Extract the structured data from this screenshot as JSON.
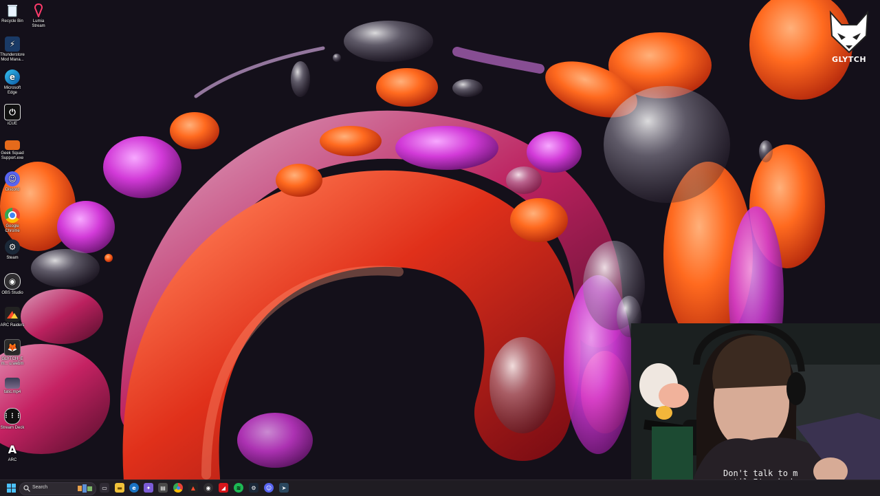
{
  "desktop": {
    "icons": [
      {
        "label": "Recycle Bin",
        "icon": "recycle-bin-icon"
      },
      {
        "label": "Lumia Stream",
        "icon": "lumia-stream-icon"
      },
      {
        "label": "Thunderstore Mod Mana...",
        "icon": "thunderstore-icon"
      },
      {
        "label": "Microsoft Edge",
        "icon": "edge-icon"
      },
      {
        "label": "iCUE",
        "icon": "icue-icon"
      },
      {
        "label": "Geek Squad Support.exe",
        "icon": "geek-squad-icon"
      },
      {
        "label": "Discord",
        "icon": "discord-icon"
      },
      {
        "label": "Google Chrome",
        "icon": "chrome-icon"
      },
      {
        "label": "Steam",
        "icon": "steam-icon"
      },
      {
        "label": "OBS Studio",
        "icon": "obs-icon"
      },
      {
        "label": "ARC Raiders",
        "icon": "arc-raiders-icon"
      },
      {
        "label": "GLYTCH_Em... u.webm",
        "icon": "video-file-icon"
      },
      {
        "label": "tatic.mp4",
        "icon": "video-file-icon"
      },
      {
        "label": "Stream Deck",
        "icon": "stream-deck-icon"
      },
      {
        "label": "ARC",
        "icon": "arc-icon"
      }
    ]
  },
  "overlay": {
    "logo_text": "GLYTCH",
    "shirt_text": "Don't talk to m\nuntil I've had"
  },
  "taskbar": {
    "search_placeholder": "Search",
    "apps": [
      "task-view-icon",
      "file-explorer-icon",
      "edge-icon",
      "copilot-icon",
      "store-icon",
      "chrome-icon",
      "arc-raiders-icon",
      "obs-icon",
      "amd-icon",
      "spotify-icon",
      "steam-icon",
      "discord-icon",
      "steam-alt-icon"
    ]
  },
  "colors": {
    "wallpaper_bg": "#14101a",
    "accent_orange": "#ff6a1f",
    "accent_magenta": "#d23ad8",
    "taskbar_bg": "#1f1c22"
  }
}
